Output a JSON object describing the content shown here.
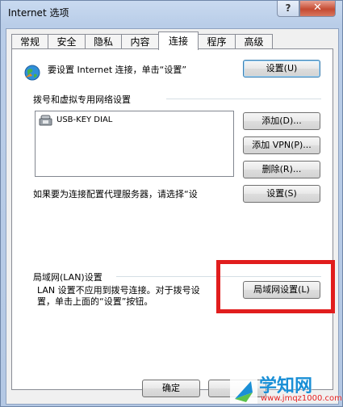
{
  "window": {
    "title": "Internet 选项",
    "help_label": "?",
    "close_label": "✕"
  },
  "tabs": [
    {
      "label": "常规"
    },
    {
      "label": "安全"
    },
    {
      "label": "隐私"
    },
    {
      "label": "内容"
    },
    {
      "label": "连接",
      "active": true
    },
    {
      "label": "程序"
    },
    {
      "label": "高级"
    }
  ],
  "connect": {
    "setup_text": "要设置 Internet 连接，单击“设置”",
    "setup_button": "设置(U)"
  },
  "dialup": {
    "group_title": "拨号和虚拟专用网络设置",
    "items": [
      {
        "label": "USB-KEY DIAL"
      }
    ],
    "add_button": "添加(D)...",
    "add_vpn_button": "添加 VPN(P)...",
    "delete_button": "删除(R)...",
    "proxy_text": "如果要为连接配置代理服务器，请选择“设",
    "settings_button": "设置(S)"
  },
  "lan": {
    "group_title": "局域网(LAN)设置",
    "description_line1": "LAN 设置不应用到拨号连接。对于拨号设",
    "description_line2": "置，单击上面的“设置”按钮。",
    "lan_button": "局域网设置(L)"
  },
  "footer": {
    "ok_button": "确定"
  },
  "watermark": {
    "brand": "学知网",
    "url": "www.jmqz1000.com"
  },
  "colors": {
    "highlight": "#e11d1d",
    "watermark_brand": "#1a8fd6"
  }
}
